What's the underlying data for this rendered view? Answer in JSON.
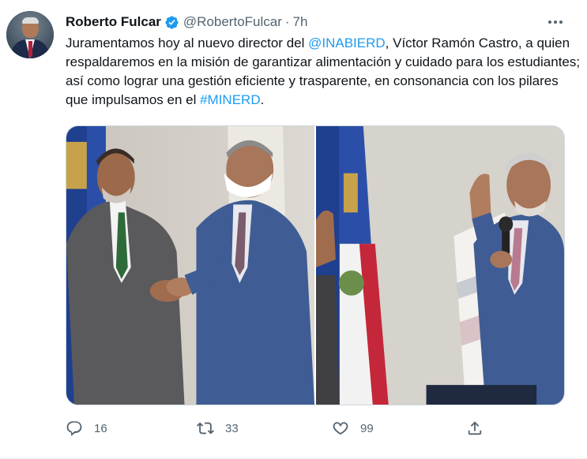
{
  "tweet": {
    "author_name": "Roberto Fulcar",
    "handle": "@RobertoFulcar",
    "separator": "·",
    "time": "7h",
    "text_parts": {
      "p1": "Juramentamos hoy al nuevo director del ",
      "mention": "@INABIERD",
      "p2": ", Víctor Ramón Castro, a quien respaldaremos en la misión de garantizar alimentación y cuidado para los estudiantes; así como lograr una gestión eficiente y trasparente, en consonancia con los pilares que impulsamos en el ",
      "hashtag": "#MINERD",
      "p3": "."
    },
    "reply_count": "16",
    "retweet_count": "33",
    "like_count": "99"
  },
  "colors": {
    "accent": "#1d9bf0",
    "text": "#0f1419",
    "secondary": "#536471"
  },
  "icons": {
    "verified": "verified-badge-icon",
    "more": "more-icon",
    "reply": "reply-icon",
    "retweet": "retweet-icon",
    "like": "like-icon",
    "share": "share-icon"
  }
}
